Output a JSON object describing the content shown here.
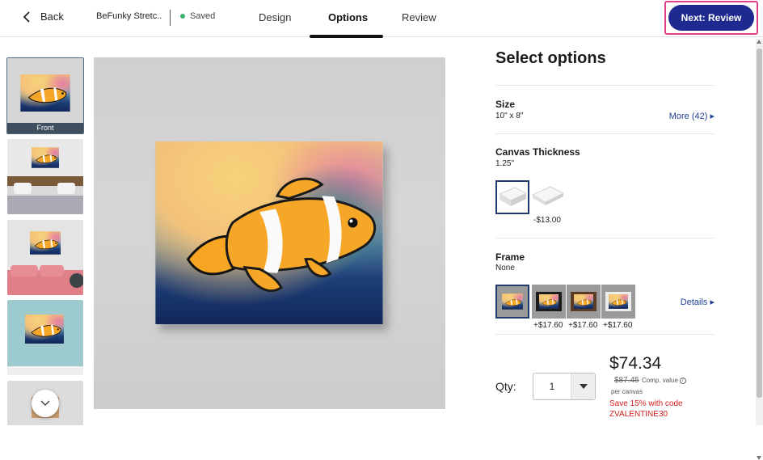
{
  "header": {
    "back_label": "Back",
    "project_name": "BeFunky Stretc...",
    "save_status": "Saved",
    "tabs": [
      {
        "label": "Design"
      },
      {
        "label": "Options"
      },
      {
        "label": "Review"
      }
    ],
    "next_label": "Next: Review"
  },
  "thumbnails": [
    {
      "label": "Front"
    }
  ],
  "options": {
    "title": "Select options",
    "size": {
      "label": "Size",
      "value": "10\" x 8\"",
      "more_label": "More (42)"
    },
    "thickness": {
      "label": "Canvas Thickness",
      "value": "1.25\"",
      "prices": [
        "",
        "-$13.00"
      ]
    },
    "frame": {
      "label": "Frame",
      "value": "None",
      "details_label": "Details",
      "prices": [
        "",
        "+$17.60",
        "+$17.60",
        "+$17.60"
      ]
    }
  },
  "purchase": {
    "qty_label": "Qty:",
    "qty_value": "1",
    "price": "$74.34",
    "old_price": "$87.45",
    "comp_label": "Comp. value",
    "per_unit": "per canvas",
    "promo": "Save 15% with code ZVALENTINE30"
  },
  "colors": {
    "accent": "#1e2a8f",
    "highlight": "#e23d8a",
    "promo": "#d42020"
  }
}
